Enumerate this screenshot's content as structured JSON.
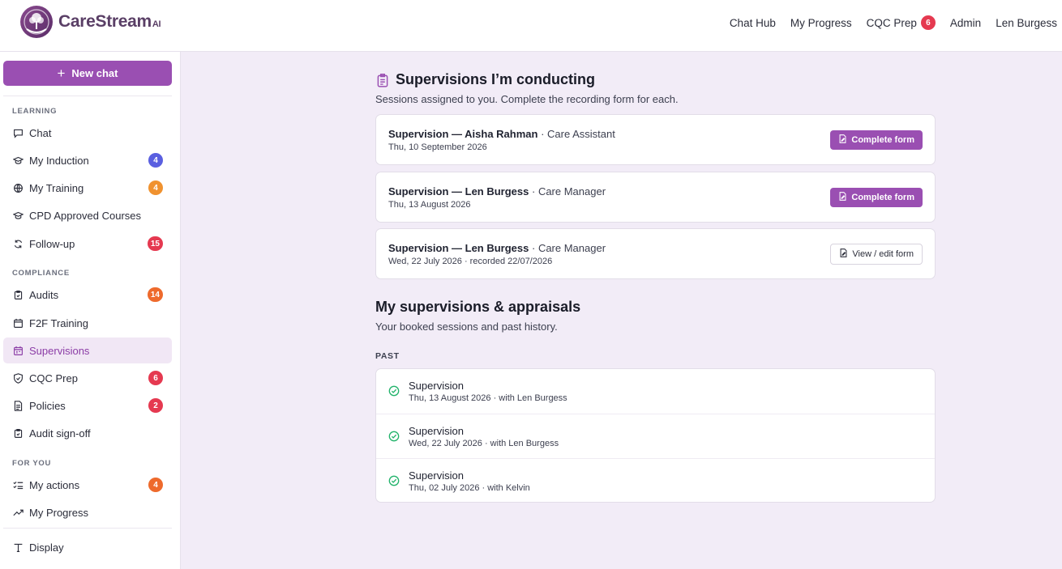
{
  "brand": {
    "name": "CareStream",
    "suffix": "AI"
  },
  "topnav": {
    "chat_hub": "Chat Hub",
    "my_progress": "My Progress",
    "cqc_prep": "CQC Prep",
    "cqc_prep_badge": "6",
    "admin": "Admin",
    "user": "Len Burgess"
  },
  "sidebar": {
    "new_chat": "New chat",
    "sections": {
      "learning": "LEARNING",
      "compliance": "COMPLIANCE",
      "for_you": "FOR YOU"
    },
    "items": {
      "chat": {
        "label": "Chat",
        "icon": "chat-bubble-icon"
      },
      "my_induction": {
        "label": "My Induction",
        "badge": "4",
        "icon": "graduation-cap-icon"
      },
      "my_training": {
        "label": "My Training",
        "badge": "4",
        "icon": "globe-icon"
      },
      "cpd_courses": {
        "label": "CPD Approved Courses",
        "icon": "graduation-cap-icon"
      },
      "follow_up": {
        "label": "Follow-up",
        "badge": "15",
        "icon": "refresh-icon"
      },
      "audits": {
        "label": "Audits",
        "badge": "14",
        "icon": "clipboard-check-icon"
      },
      "f2f_training": {
        "label": "F2F Training",
        "icon": "calendar-icon"
      },
      "supervisions": {
        "label": "Supervisions",
        "icon": "calendar-icon",
        "active": true
      },
      "cqc_prep": {
        "label": "CQC Prep",
        "badge": "6",
        "icon": "shield-check-icon"
      },
      "policies": {
        "label": "Policies",
        "badge": "2",
        "icon": "document-icon"
      },
      "audit_signoff": {
        "label": "Audit sign-off",
        "icon": "clipboard-check-icon"
      },
      "my_actions": {
        "label": "My actions",
        "badge": "4",
        "icon": "checklist-icon"
      },
      "my_progress": {
        "label": "My Progress",
        "icon": "trend-up-icon"
      },
      "display": {
        "label": "Display",
        "icon": "text-type-icon"
      }
    }
  },
  "conducting": {
    "title": "Supervisions I’m conducting",
    "subtitle": "Sessions assigned to you. Complete the recording form for each.",
    "cards": [
      {
        "title": "Supervision — Aisha Rahman",
        "role": "· Care Assistant",
        "date": "Thu, 10 September 2026",
        "action": "Complete form"
      },
      {
        "title": "Supervision — Len Burgess",
        "role": "· Care Manager",
        "date": "Thu, 13 August 2026",
        "action": "Complete form"
      },
      {
        "title": "Supervision — Len Burgess",
        "role": "· Care Manager",
        "date": "Wed, 22 July 2026 · recorded 22/07/2026",
        "action": "View / edit form"
      }
    ]
  },
  "mine": {
    "title": "My supervisions & appraisals",
    "subtitle": "Your booked sessions and past history.",
    "past_label": "PAST",
    "history": [
      {
        "title": "Supervision",
        "detail": "Thu, 13 August 2026 · with Len Burgess"
      },
      {
        "title": "Supervision",
        "detail": "Wed, 22 July 2026 · with Len Burgess"
      },
      {
        "title": "Supervision",
        "detail": "Thu, 02 July 2026 · with Kelvin"
      }
    ]
  },
  "colors": {
    "accent": "#9a4fb2",
    "background": "#f2ecf7",
    "success": "#22b36b",
    "badge_red": "#e53950",
    "badge_blue": "#5a5fe0",
    "badge_orange": "#f0922f"
  }
}
